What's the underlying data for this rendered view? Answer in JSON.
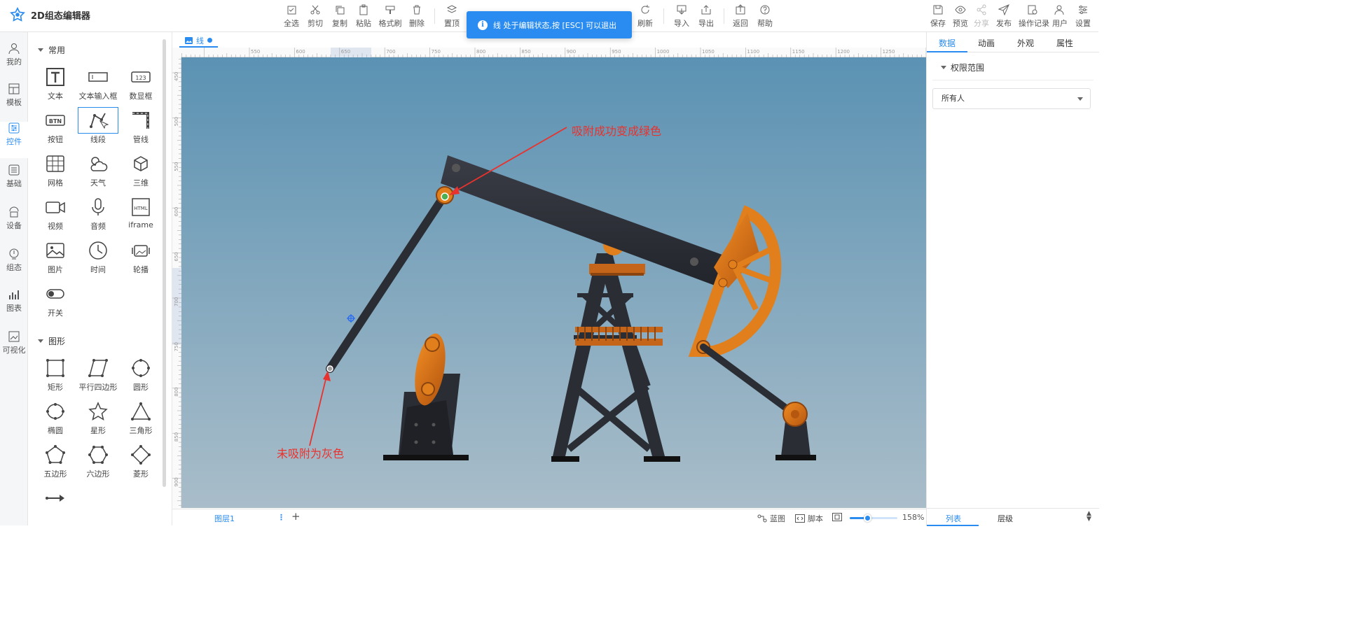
{
  "app": {
    "title": "2D组态编辑器"
  },
  "toolbar": {
    "select_all": "全选",
    "cut": "剪切",
    "copy": "复制",
    "paste": "粘贴",
    "format_brush": "格式刷",
    "delete": "删除",
    "to_top": "置顶",
    "refresh": "刷新",
    "import": "导入",
    "export": "导出",
    "back": "返回",
    "help": "帮助",
    "save": "保存",
    "preview": "预览",
    "share": "分享",
    "publish": "发布",
    "history": "操作记录",
    "user": "用户",
    "settings": "设置"
  },
  "toast": {
    "text": "线 处于编辑状态,按 [ESC] 可以退出"
  },
  "leftnav": {
    "items": [
      {
        "label": "我的",
        "icon": "user-icon"
      },
      {
        "label": "模板",
        "icon": "template-icon"
      },
      {
        "label": "控件",
        "icon": "sliders-icon"
      },
      {
        "label": "基础",
        "icon": "basic-icon"
      },
      {
        "label": "设备",
        "icon": "device-icon"
      },
      {
        "label": "组态",
        "icon": "config-icon"
      },
      {
        "label": "图表",
        "icon": "chart-icon"
      },
      {
        "label": "可视化",
        "icon": "visual-icon"
      }
    ],
    "active": "控件"
  },
  "panel": {
    "common_title": "常用",
    "common": [
      "文本",
      "文本输入框",
      "数显框",
      "按钮",
      "线段",
      "管线",
      "网格",
      "天气",
      "三维",
      "视频",
      "音频",
      "iframe",
      "图片",
      "时间",
      "轮播",
      "开关"
    ],
    "shapes_title": "图形",
    "shapes": [
      "矩形",
      "平行四边形",
      "圆形",
      "椭圆",
      "星形",
      "三角形",
      "五边形",
      "六边形",
      "菱形",
      "箭头"
    ],
    "selected": "线段"
  },
  "editor": {
    "tab_label": "线",
    "ruler_h": [
      "550",
      "600",
      "650",
      "700",
      "750",
      "800",
      "850",
      "900",
      "950",
      "1000",
      "1050",
      "1100",
      "1150",
      "1200",
      "1250"
    ],
    "ruler_v": [
      "450",
      "500",
      "550",
      "600",
      "650",
      "700",
      "750",
      "800",
      "850",
      "900"
    ],
    "annotation_snapped": "吸附成功变成绿色",
    "annotation_unsnapped": "未吸附为灰色",
    "snap_color_success": "#4caf50",
    "snap_color_none": "#9e9e9e",
    "annotation_color": "#e8322e"
  },
  "bottombar": {
    "layer": "图层1",
    "blueprint": "蓝图",
    "script": "脚本",
    "zoom_label": "158%",
    "zoom_fraction": 0.38
  },
  "rpanel": {
    "tabs": [
      "数据",
      "动画",
      "外观",
      "属性"
    ],
    "active_tab": "数据",
    "section": "权限范围",
    "permission_value": "所有人",
    "bottom_tabs": [
      "列表",
      "层级"
    ]
  }
}
